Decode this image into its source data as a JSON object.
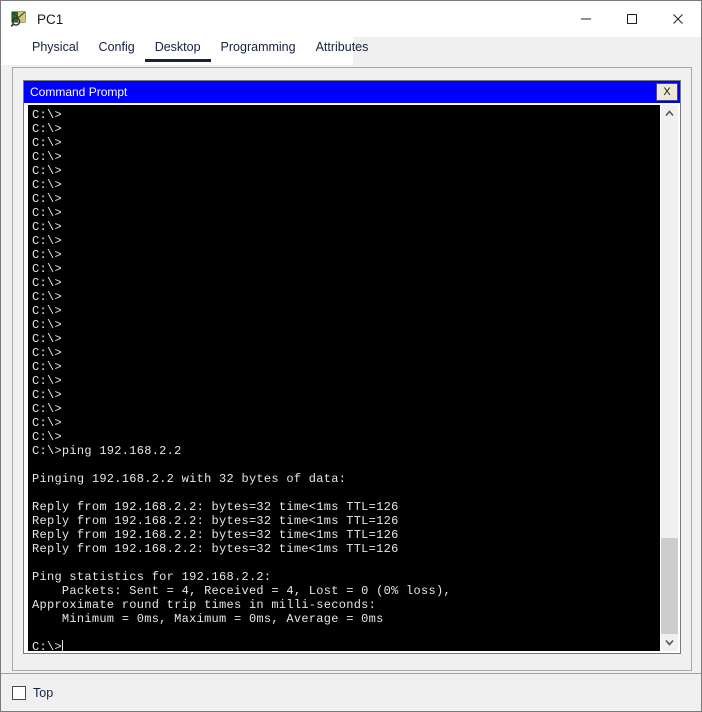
{
  "window": {
    "title": "PC1",
    "icon": "packet-tracer-device-icon",
    "controls": {
      "minimize": "—",
      "maximize": "□",
      "close": "✕"
    }
  },
  "tabs": [
    {
      "label": "Physical",
      "active": false
    },
    {
      "label": "Config",
      "active": false
    },
    {
      "label": "Desktop",
      "active": true
    },
    {
      "label": "Programming",
      "active": false
    },
    {
      "label": "Attributes",
      "active": false
    }
  ],
  "command_prompt": {
    "title": "Command Prompt",
    "close_label": "X",
    "prompt_lines_count": 24,
    "prompt": "C:\\>",
    "command": "ping 192.168.2.2",
    "output": [
      "",
      "Pinging 192.168.2.2 with 32 bytes of data:",
      "",
      "Reply from 192.168.2.2: bytes=32 time<1ms TTL=126",
      "Reply from 192.168.2.2: bytes=32 time<1ms TTL=126",
      "Reply from 192.168.2.2: bytes=32 time<1ms TTL=126",
      "Reply from 192.168.2.2: bytes=32 time<1ms TTL=126",
      "",
      "Ping statistics for 192.168.2.2:",
      "    Packets: Sent = 4, Received = 4, Lost = 0 (0% loss),",
      "Approximate round trip times in milli-seconds:",
      "    Minimum = 0ms, Maximum = 0ms, Average = 0ms",
      ""
    ],
    "final_prompt": "C:\\>",
    "ping": {
      "target": "192.168.2.2",
      "bytes": 32,
      "ttl": 126,
      "sent": 4,
      "received": 4,
      "lost": 0,
      "loss_percent": "0%",
      "minimum_ms": "0ms",
      "maximum_ms": "0ms",
      "average_ms": "0ms"
    },
    "scrollbar": {
      "up_arrow": "▲",
      "down_arrow": "▼"
    }
  },
  "footer": {
    "top_label": "Top",
    "top_checked": false
  },
  "colors": {
    "cmd_titlebar": "#0000ff",
    "terminal_bg": "#000000",
    "terminal_fg": "#e6e6e6",
    "tab_active_underline": "#16213e",
    "window_bg": "#f0f0f0"
  }
}
